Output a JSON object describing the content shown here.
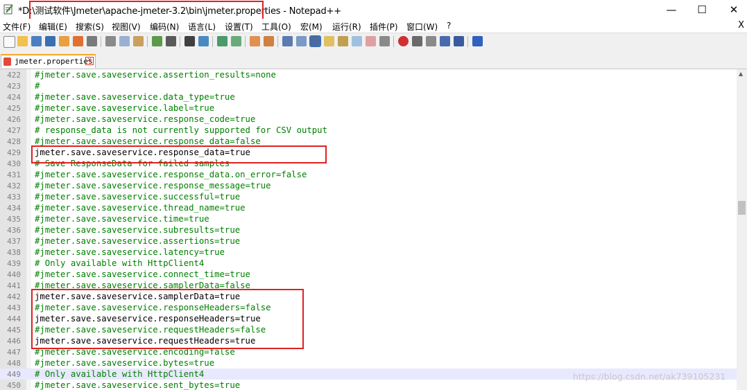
{
  "window": {
    "title_prefix": "*D:\\",
    "title_path": "测试软件\\Jmeter\\apache-jmeter-3.2\\bin\\jmeter.properties",
    "title_suffix": " - Notepad++"
  },
  "window_controls": {
    "minimize": "—",
    "maximize": "☐",
    "close": "✕"
  },
  "menu": {
    "items": [
      "文件(F)",
      "编辑(E)",
      "搜索(S)",
      "视图(V)",
      "编码(N)",
      "语言(L)",
      "设置(T)",
      "工具(O)",
      "宏(M)",
      "运行(R)",
      "插件(P)",
      "窗口(W)",
      "?"
    ],
    "close": "X"
  },
  "tab": {
    "label": "jmeter.properties",
    "close_glyph": "✕"
  },
  "lines": [
    {
      "n": "422",
      "text": "#jmeter.save.saveservice.assertion_results=none",
      "kind": "comment"
    },
    {
      "n": "423",
      "text": "#",
      "kind": "comment"
    },
    {
      "n": "424",
      "text": "#jmeter.save.saveservice.data_type=true",
      "kind": "comment"
    },
    {
      "n": "425",
      "text": "#jmeter.save.saveservice.label=true",
      "kind": "comment"
    },
    {
      "n": "426",
      "text": "#jmeter.save.saveservice.response_code=true",
      "kind": "comment"
    },
    {
      "n": "427",
      "text": "# response_data is not currently supported for CSV output",
      "kind": "comment"
    },
    {
      "n": "428",
      "text": "#jmeter.save.saveservice.response_data=false",
      "kind": "comment"
    },
    {
      "n": "429",
      "text": "jmeter.save.saveservice.response_data=true",
      "kind": "plain"
    },
    {
      "n": "430",
      "text": "# Save ResponseData for failed samples",
      "kind": "comment"
    },
    {
      "n": "431",
      "text": "#jmeter.save.saveservice.response_data.on_error=false",
      "kind": "comment"
    },
    {
      "n": "432",
      "text": "#jmeter.save.saveservice.response_message=true",
      "kind": "comment"
    },
    {
      "n": "433",
      "text": "#jmeter.save.saveservice.successful=true",
      "kind": "comment"
    },
    {
      "n": "434",
      "text": "#jmeter.save.saveservice.thread_name=true",
      "kind": "comment"
    },
    {
      "n": "435",
      "text": "#jmeter.save.saveservice.time=true",
      "kind": "comment"
    },
    {
      "n": "436",
      "text": "#jmeter.save.saveservice.subresults=true",
      "kind": "comment"
    },
    {
      "n": "437",
      "text": "#jmeter.save.saveservice.assertions=true",
      "kind": "comment"
    },
    {
      "n": "438",
      "text": "#jmeter.save.saveservice.latency=true",
      "kind": "comment"
    },
    {
      "n": "439",
      "text": "# Only available with HttpClient4",
      "kind": "comment"
    },
    {
      "n": "440",
      "text": "#jmeter.save.saveservice.connect_time=true",
      "kind": "comment"
    },
    {
      "n": "441",
      "text": "#jmeter.save.saveservice.samplerData=false",
      "kind": "comment"
    },
    {
      "n": "442",
      "text": "jmeter.save.saveservice.samplerData=true",
      "kind": "plain"
    },
    {
      "n": "443",
      "text": "#jmeter.save.saveservice.responseHeaders=false",
      "kind": "comment"
    },
    {
      "n": "444",
      "text": "jmeter.save.saveservice.responseHeaders=true",
      "kind": "plain"
    },
    {
      "n": "445",
      "text": "#jmeter.save.saveservice.requestHeaders=false",
      "kind": "comment"
    },
    {
      "n": "446",
      "text": "jmeter.save.saveservice.requestHeaders=true",
      "kind": "plain"
    },
    {
      "n": "447",
      "text": "#jmeter.save.saveservice.encoding=false",
      "kind": "comment"
    },
    {
      "n": "448",
      "text": "#jmeter.save.saveservice.bytes=true",
      "kind": "comment"
    },
    {
      "n": "449",
      "text": "# Only available with HttpClient4",
      "kind": "comment",
      "current": true
    },
    {
      "n": "450",
      "text": "#jmeter.save.saveservice.sent_bytes=true",
      "kind": "comment"
    }
  ],
  "watermark": "https://blog.csdn.net/ak739105231",
  "colors": {
    "comment": "#008000",
    "plain": "#000000",
    "highlight_box": "#e02020",
    "current_line": "#e8e8ff"
  }
}
